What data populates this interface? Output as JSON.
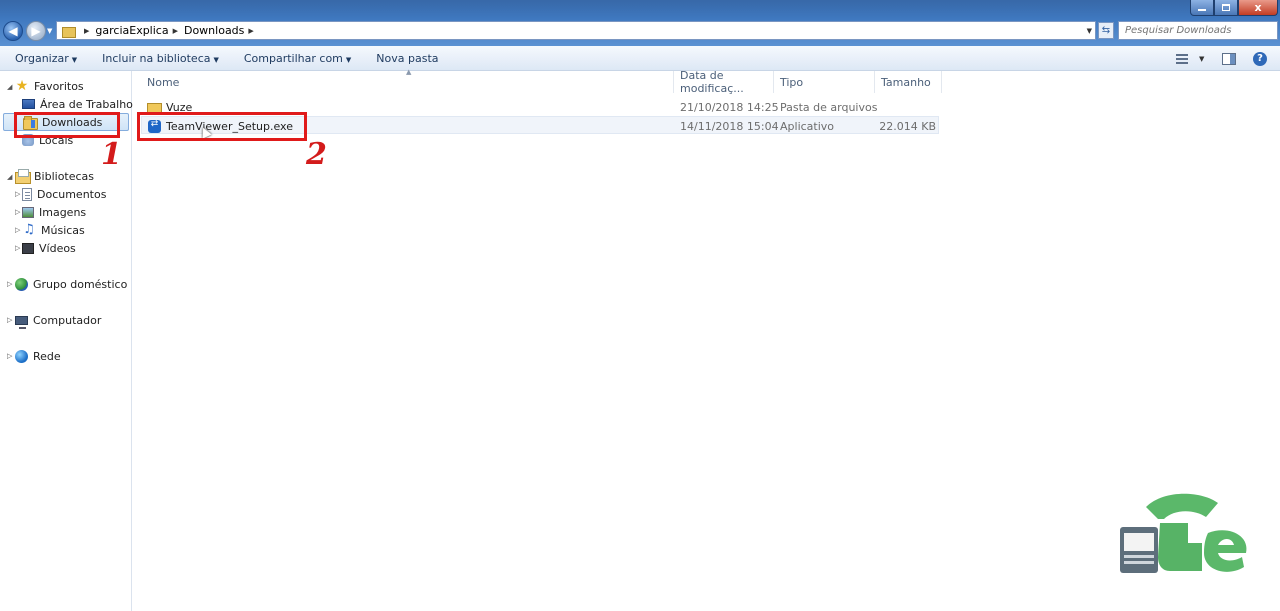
{
  "window": {
    "minimize_label": "",
    "maximize_label": "",
    "close_label": "x"
  },
  "address": {
    "segments": [
      "garciaExplica",
      "Downloads"
    ],
    "search_placeholder": "Pesquisar Downloads"
  },
  "toolbar": {
    "organize": "Organizar",
    "include_library": "Incluir na biblioteca",
    "share_with": "Compartilhar com",
    "new_folder": "Nova pasta"
  },
  "nav": {
    "favorites": {
      "label": "Favoritos",
      "items": [
        {
          "label": "Área de Trabalho",
          "icon": "desktop-icon"
        },
        {
          "label": "Downloads",
          "icon": "downloads-folder-icon"
        },
        {
          "label": "Locais",
          "icon": "recent-places-icon"
        }
      ]
    },
    "libraries": {
      "label": "Bibliotecas",
      "items": [
        {
          "label": "Documentos",
          "icon": "documents-icon"
        },
        {
          "label": "Imagens",
          "icon": "pictures-icon"
        },
        {
          "label": "Músicas",
          "icon": "music-icon"
        },
        {
          "label": "Vídeos",
          "icon": "videos-icon"
        }
      ]
    },
    "homegroup": "Grupo doméstico",
    "computer": "Computador",
    "network": "Rede"
  },
  "filelist": {
    "columns": {
      "name": "Nome",
      "date": "Data de modificaç...",
      "type": "Tipo",
      "size": "Tamanho"
    },
    "rows": [
      {
        "name": "Vuze",
        "date": "21/10/2018 14:25",
        "type": "Pasta de arquivos",
        "size": "",
        "icon": "folder-icon"
      },
      {
        "name": "TeamViewer_Setup.exe",
        "date": "14/11/2018 15:04",
        "type": "Aplicativo",
        "size": "22.014 KB",
        "icon": "teamviewer-icon"
      }
    ]
  },
  "annotations": {
    "step1": "1",
    "step2": "2",
    "color": "#e01a1a"
  },
  "colors": {
    "accent": "#3f78bf",
    "selection": "#cfe4f7",
    "logo_green": "#5bb86a"
  }
}
